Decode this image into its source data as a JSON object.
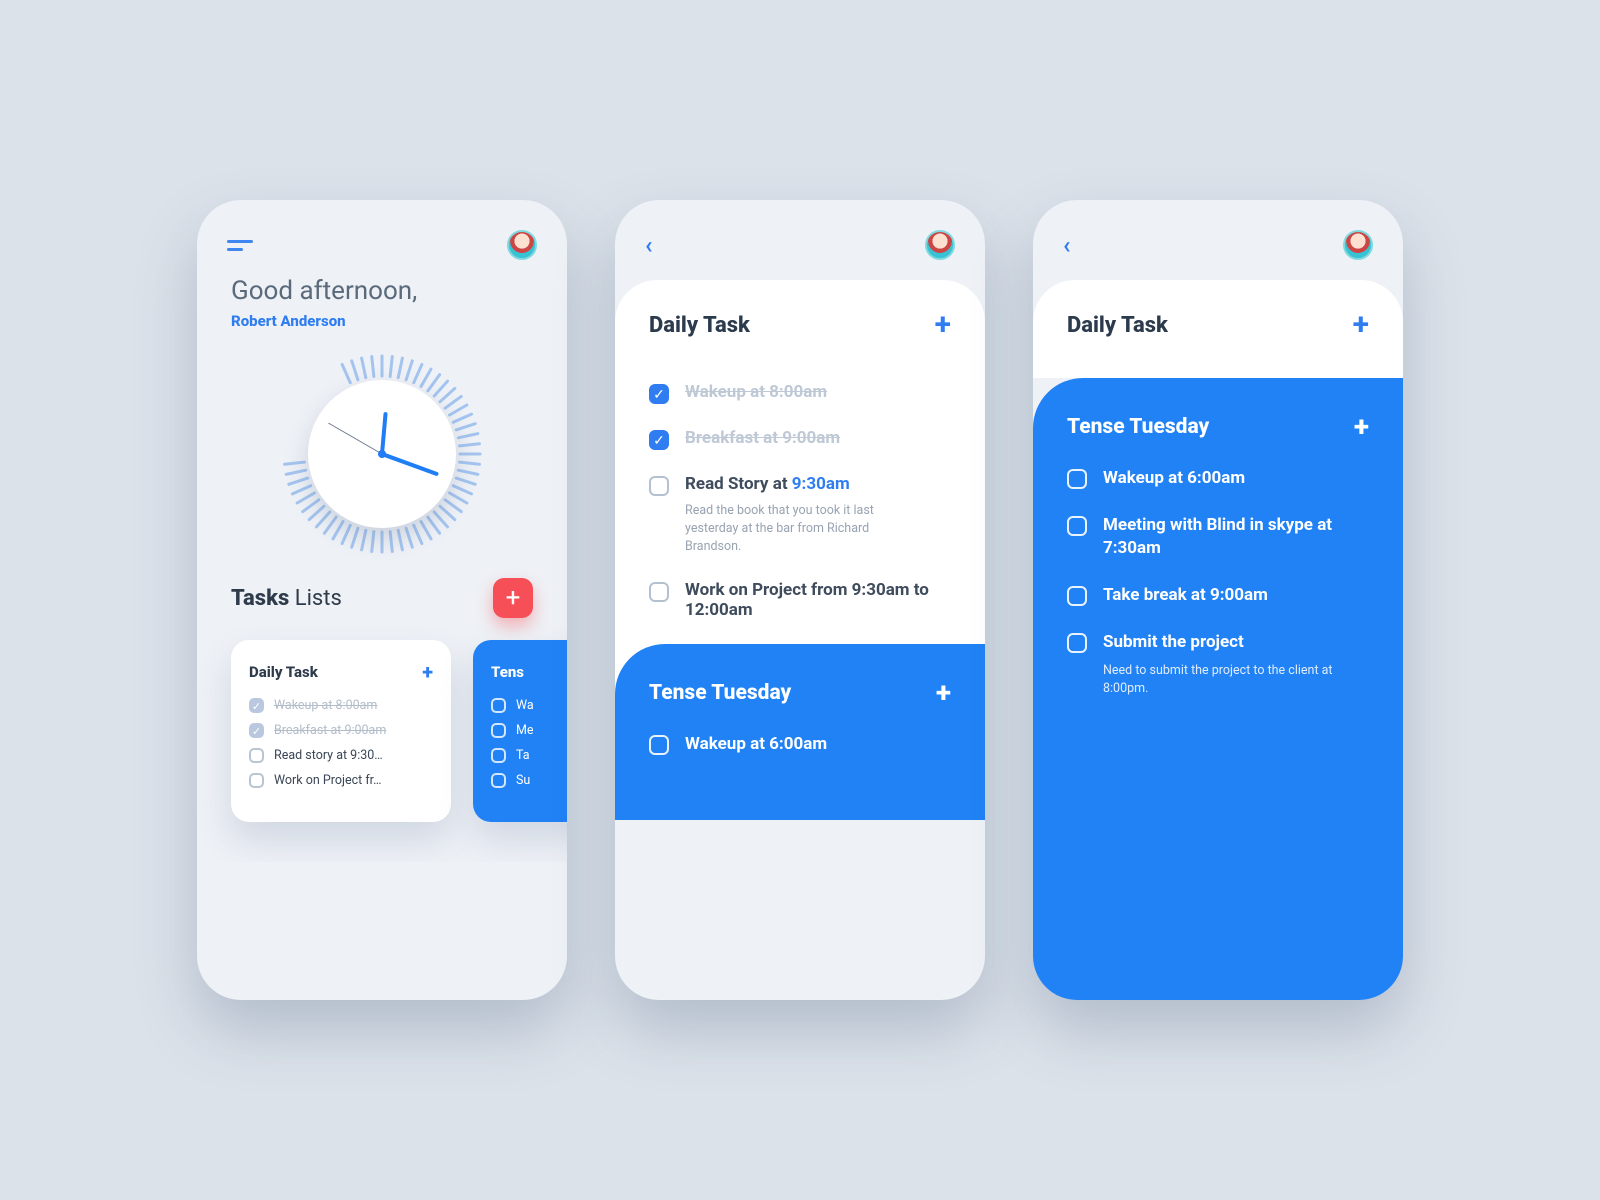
{
  "colors": {
    "accent": "#2f7df0",
    "danger": "#f64f57",
    "blue_panel": "#2182f5"
  },
  "home": {
    "greeting": "Good afternoon,",
    "user_name": "Robert Anderson",
    "section_title_bold": "Tasks",
    "section_title_rest": "Lists",
    "cards": [
      {
        "title": "Daily Task",
        "items": [
          {
            "text": "Wakeup at 8:00am",
            "done": true
          },
          {
            "text": "Breakfast at 9:00am",
            "done": true
          },
          {
            "text": "Read story at 9:30…",
            "done": false
          },
          {
            "text": "Work on Project fr…",
            "done": false
          }
        ]
      },
      {
        "title": "Tens",
        "items": [
          {
            "text": "Wa",
            "done": false
          },
          {
            "text": "Me",
            "done": false
          },
          {
            "text": "Ta",
            "done": false
          },
          {
            "text": "Su",
            "done": false
          }
        ]
      }
    ]
  },
  "daily": {
    "title": "Daily Task",
    "tasks": [
      {
        "title": "Wakeup at 8:00am",
        "done": true
      },
      {
        "title": "Breakfast at 9:00am",
        "done": true
      },
      {
        "title_pre": "Read Story at ",
        "title_time": "9:30am",
        "note": "Read the book that you took it last yesterday at the bar from Richard Brandson.",
        "done": false
      },
      {
        "title": "Work on Project from 9:30am to 12:00am",
        "done": false
      }
    ],
    "next_list": {
      "title": "Tense Tuesday",
      "first_item": "Wakeup at 6:00am"
    }
  },
  "tuesday": {
    "header": "Daily Task",
    "title": "Tense Tuesday",
    "items": [
      {
        "title": "Wakeup at 6:00am"
      },
      {
        "title": "Meeting with Blind in skype at 7:30am"
      },
      {
        "title": "Take break at 9:00am"
      },
      {
        "title": "Submit the project",
        "note": "Need to submit the project to the client at 8:00pm."
      }
    ]
  }
}
